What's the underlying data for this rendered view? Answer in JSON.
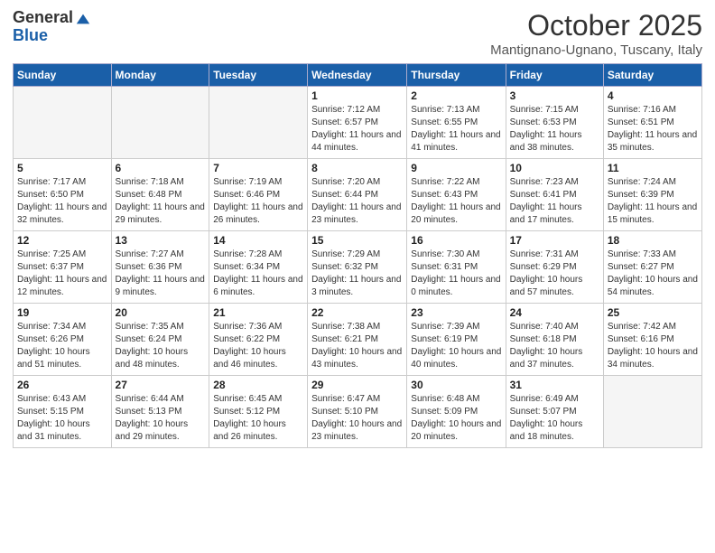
{
  "logo": {
    "general": "General",
    "blue": "Blue"
  },
  "header": {
    "month": "October 2025",
    "location": "Mantignano-Ugnano, Tuscany, Italy"
  },
  "days_of_week": [
    "Sunday",
    "Monday",
    "Tuesday",
    "Wednesday",
    "Thursday",
    "Friday",
    "Saturday"
  ],
  "weeks": [
    [
      {
        "day": "",
        "info": ""
      },
      {
        "day": "",
        "info": ""
      },
      {
        "day": "",
        "info": ""
      },
      {
        "day": "1",
        "info": "Sunrise: 7:12 AM\nSunset: 6:57 PM\nDaylight: 11 hours and 44 minutes."
      },
      {
        "day": "2",
        "info": "Sunrise: 7:13 AM\nSunset: 6:55 PM\nDaylight: 11 hours and 41 minutes."
      },
      {
        "day": "3",
        "info": "Sunrise: 7:15 AM\nSunset: 6:53 PM\nDaylight: 11 hours and 38 minutes."
      },
      {
        "day": "4",
        "info": "Sunrise: 7:16 AM\nSunset: 6:51 PM\nDaylight: 11 hours and 35 minutes."
      }
    ],
    [
      {
        "day": "5",
        "info": "Sunrise: 7:17 AM\nSunset: 6:50 PM\nDaylight: 11 hours and 32 minutes."
      },
      {
        "day": "6",
        "info": "Sunrise: 7:18 AM\nSunset: 6:48 PM\nDaylight: 11 hours and 29 minutes."
      },
      {
        "day": "7",
        "info": "Sunrise: 7:19 AM\nSunset: 6:46 PM\nDaylight: 11 hours and 26 minutes."
      },
      {
        "day": "8",
        "info": "Sunrise: 7:20 AM\nSunset: 6:44 PM\nDaylight: 11 hours and 23 minutes."
      },
      {
        "day": "9",
        "info": "Sunrise: 7:22 AM\nSunset: 6:43 PM\nDaylight: 11 hours and 20 minutes."
      },
      {
        "day": "10",
        "info": "Sunrise: 7:23 AM\nSunset: 6:41 PM\nDaylight: 11 hours and 17 minutes."
      },
      {
        "day": "11",
        "info": "Sunrise: 7:24 AM\nSunset: 6:39 PM\nDaylight: 11 hours and 15 minutes."
      }
    ],
    [
      {
        "day": "12",
        "info": "Sunrise: 7:25 AM\nSunset: 6:37 PM\nDaylight: 11 hours and 12 minutes."
      },
      {
        "day": "13",
        "info": "Sunrise: 7:27 AM\nSunset: 6:36 PM\nDaylight: 11 hours and 9 minutes."
      },
      {
        "day": "14",
        "info": "Sunrise: 7:28 AM\nSunset: 6:34 PM\nDaylight: 11 hours and 6 minutes."
      },
      {
        "day": "15",
        "info": "Sunrise: 7:29 AM\nSunset: 6:32 PM\nDaylight: 11 hours and 3 minutes."
      },
      {
        "day": "16",
        "info": "Sunrise: 7:30 AM\nSunset: 6:31 PM\nDaylight: 11 hours and 0 minutes."
      },
      {
        "day": "17",
        "info": "Sunrise: 7:31 AM\nSunset: 6:29 PM\nDaylight: 10 hours and 57 minutes."
      },
      {
        "day": "18",
        "info": "Sunrise: 7:33 AM\nSunset: 6:27 PM\nDaylight: 10 hours and 54 minutes."
      }
    ],
    [
      {
        "day": "19",
        "info": "Sunrise: 7:34 AM\nSunset: 6:26 PM\nDaylight: 10 hours and 51 minutes."
      },
      {
        "day": "20",
        "info": "Sunrise: 7:35 AM\nSunset: 6:24 PM\nDaylight: 10 hours and 48 minutes."
      },
      {
        "day": "21",
        "info": "Sunrise: 7:36 AM\nSunset: 6:22 PM\nDaylight: 10 hours and 46 minutes."
      },
      {
        "day": "22",
        "info": "Sunrise: 7:38 AM\nSunset: 6:21 PM\nDaylight: 10 hours and 43 minutes."
      },
      {
        "day": "23",
        "info": "Sunrise: 7:39 AM\nSunset: 6:19 PM\nDaylight: 10 hours and 40 minutes."
      },
      {
        "day": "24",
        "info": "Sunrise: 7:40 AM\nSunset: 6:18 PM\nDaylight: 10 hours and 37 minutes."
      },
      {
        "day": "25",
        "info": "Sunrise: 7:42 AM\nSunset: 6:16 PM\nDaylight: 10 hours and 34 minutes."
      }
    ],
    [
      {
        "day": "26",
        "info": "Sunrise: 6:43 AM\nSunset: 5:15 PM\nDaylight: 10 hours and 31 minutes."
      },
      {
        "day": "27",
        "info": "Sunrise: 6:44 AM\nSunset: 5:13 PM\nDaylight: 10 hours and 29 minutes."
      },
      {
        "day": "28",
        "info": "Sunrise: 6:45 AM\nSunset: 5:12 PM\nDaylight: 10 hours and 26 minutes."
      },
      {
        "day": "29",
        "info": "Sunrise: 6:47 AM\nSunset: 5:10 PM\nDaylight: 10 hours and 23 minutes."
      },
      {
        "day": "30",
        "info": "Sunrise: 6:48 AM\nSunset: 5:09 PM\nDaylight: 10 hours and 20 minutes."
      },
      {
        "day": "31",
        "info": "Sunrise: 6:49 AM\nSunset: 5:07 PM\nDaylight: 10 hours and 18 minutes."
      },
      {
        "day": "",
        "info": ""
      }
    ]
  ]
}
